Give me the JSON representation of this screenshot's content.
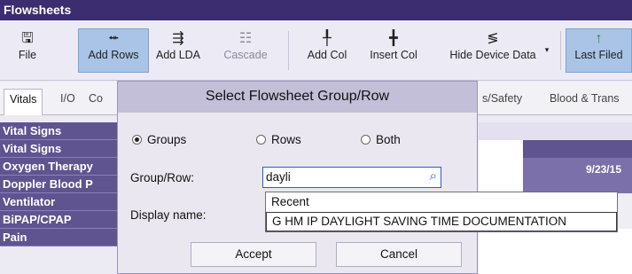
{
  "title": "Flowsheets",
  "toolbar": {
    "file": "File",
    "add_rows": "Add Rows",
    "add_lda": "Add LDA",
    "cascade": "Cascade",
    "add_col": "Add Col",
    "insert_col": "Insert Col",
    "hide_device_data": "Hide Device Data",
    "last_filed": "Last Filed"
  },
  "tabs": {
    "vitals": "Vitals",
    "io": "I/O",
    "co": "Co",
    "safety": "s/Safety",
    "blood": "Blood & Trans"
  },
  "sidebar": {
    "items": [
      "Vital Signs",
      "Vital Signs",
      "Oxygen Therapy",
      "Doppler Blood P",
      "Ventilator",
      "BiPAP/CPAP",
      "Pain"
    ]
  },
  "grid": {
    "date": "9/23/15"
  },
  "dialog": {
    "title": "Select Flowsheet Group/Row",
    "radio_groups": "Groups",
    "radio_rows": "Rows",
    "radio_both": "Both",
    "selected_radio": "Groups",
    "group_row_label": "Group/Row:",
    "group_row_value": "dayli",
    "display_name_label": "Display name:",
    "dropdown": [
      "Recent",
      "G HM IP DAYLIGHT SAVING TIME DOCUMENTATION"
    ],
    "accept": "Accept",
    "cancel": "Cancel"
  }
}
